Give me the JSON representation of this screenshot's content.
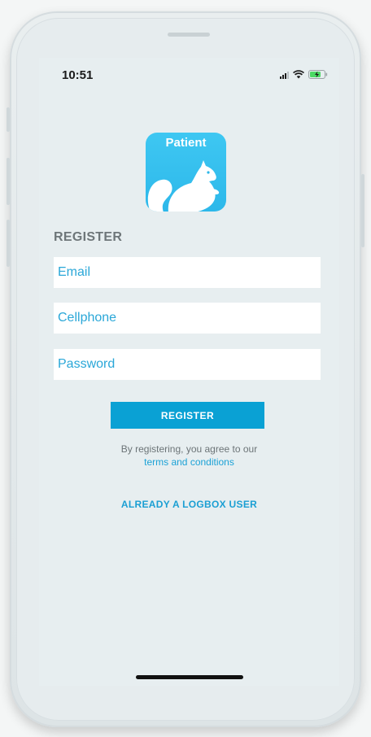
{
  "status_bar": {
    "time": "10:51",
    "icons": [
      "signal-icon",
      "wifi-icon",
      "battery-charging-icon"
    ]
  },
  "app_icon": {
    "label": "Patient",
    "graphic": "squirrel-icon"
  },
  "form": {
    "heading": "REGISTER",
    "email_placeholder": "Email",
    "cellphone_placeholder": "Cellphone",
    "password_placeholder": "Password",
    "register_button_label": "REGISTER"
  },
  "agreement": {
    "text": "By registering, you agree to our",
    "link_text": "terms and conditions"
  },
  "existing_user_link": "ALREADY A LOGBOX USER",
  "colors": {
    "accent": "#0aa1d4",
    "link": "#1ca2d6",
    "screen_bg": "#e7eef0",
    "heading": "#6e7679"
  }
}
